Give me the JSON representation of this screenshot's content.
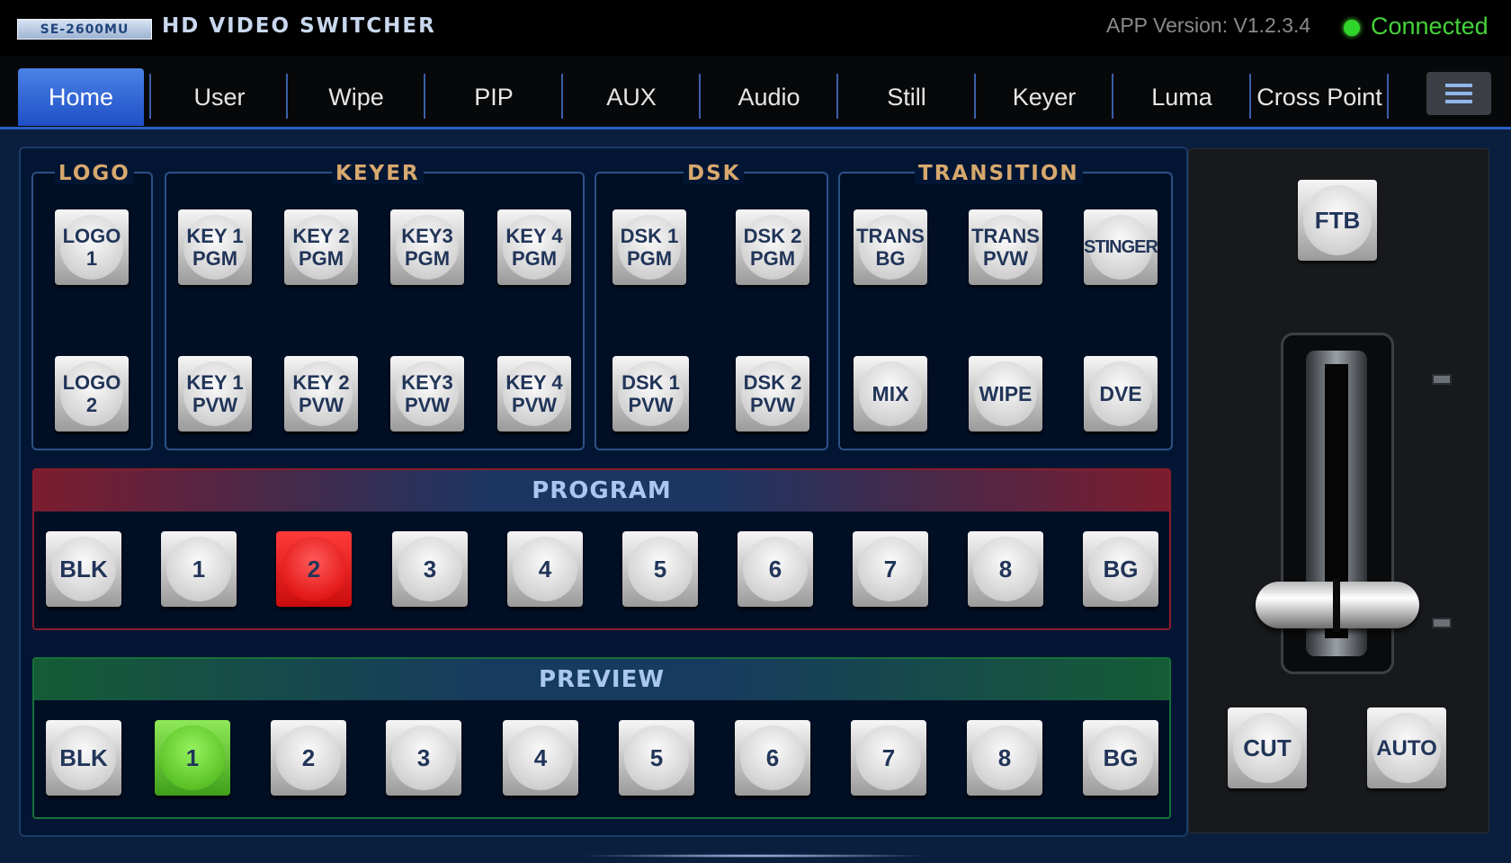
{
  "header": {
    "model_badge": "SE-2600MU",
    "title": "HD VIDEO SWITCHER",
    "app_version": "APP Version: V1.2.3.4",
    "connection_status": "Connected",
    "status_color": "#45d23a"
  },
  "tabs": [
    {
      "label": "Home",
      "active": true
    },
    {
      "label": "User"
    },
    {
      "label": "Wipe"
    },
    {
      "label": "PIP"
    },
    {
      "label": "AUX"
    },
    {
      "label": "Audio"
    },
    {
      "label": "Still"
    },
    {
      "label": "Keyer"
    },
    {
      "label": "Luma"
    },
    {
      "label": "Cross Point"
    }
  ],
  "menu_icon": "hamburger-menu-icon",
  "groups": {
    "logo": {
      "title": "LOGO",
      "buttons": [
        "LOGO 1",
        "LOGO 2"
      ]
    },
    "keyer": {
      "title": "KEYER",
      "buttons": [
        "KEY 1 PGM",
        "KEY 2 PGM",
        "KEY3 PGM",
        "KEY 4 PGM",
        "KEY 1 PVW",
        "KEY 2 PVW",
        "KEY3 PVW",
        "KEY 4 PVW"
      ]
    },
    "dsk": {
      "title": "DSK",
      "buttons": [
        "DSK 1 PGM",
        "DSK 2 PGM",
        "DSK 1 PVW",
        "DSK 2 PVW"
      ]
    },
    "transition": {
      "title": "TRANSITION",
      "buttons": [
        "TRANS BG",
        "TRANS PVW",
        "STINGER",
        "MIX",
        "WIPE",
        "DVE"
      ]
    }
  },
  "program": {
    "title": "PROGRAM",
    "buttons": [
      "BLK",
      "1",
      "2",
      "3",
      "4",
      "5",
      "6",
      "7",
      "8",
      "BG"
    ],
    "selected": "2",
    "selected_color": "#e41a1a"
  },
  "preview": {
    "title": "PREVIEW",
    "buttons": [
      "BLK",
      "1",
      "2",
      "3",
      "4",
      "5",
      "6",
      "7",
      "8",
      "BG"
    ],
    "selected": "1",
    "selected_color": "#5cc428"
  },
  "transition_controls": {
    "ftb": "FTB",
    "cut": "CUT",
    "auto": "AUTO"
  },
  "colors": {
    "accent": "#2a5fc2",
    "group_title": "#d8a86e",
    "bus_title": "#a9c7ef"
  }
}
